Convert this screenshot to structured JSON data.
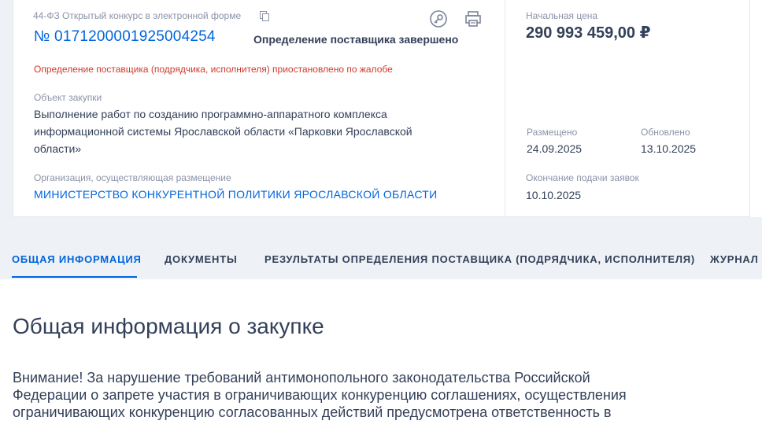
{
  "card": {
    "law_type": "44-ФЗ Открытый конкурс в электронной форме",
    "purchase_number": "№ 0171200001925004254",
    "status": "Определение поставщика завершено",
    "suspend_note": "Определение поставщика (подрядчика, исполнителя) приостановлено по жалобе",
    "object_label": "Объект закупки",
    "object_text": "Выполнение работ по созданию программно-аппаратного комплекса информационной системы Ярославской области «Парковки Ярославской области»",
    "org_label": "Организация, осуществляющая размещение",
    "org_name": "МИНИСТЕРСТВО КОНКУРЕНТНОЙ ПОЛИТИКИ ЯРОСЛАВСКОЙ ОБЛАСТИ",
    "price_label": "Начальная цена",
    "price": "290 993 459,00 ₽",
    "placed_label": "Размещено",
    "placed_date": "24.09.2025",
    "updated_label": "Обновлено",
    "updated_date": "13.10.2025",
    "end_label": "Окончание подачи заявок",
    "end_date": "10.10.2025",
    "icons": [
      "copy-icon",
      "key-icon",
      "print-icon"
    ]
  },
  "tabs": [
    {
      "label": "ОБЩАЯ ИНФОРМАЦИЯ",
      "active": true
    },
    {
      "label": "ДОКУМЕНТЫ",
      "active": false
    },
    {
      "label": "РЕЗУЛЬТАТЫ ОПРЕДЕЛЕНИЯ ПОСТАВЩИКА (ПОДРЯДЧИКА, ИСПОЛНИТЕЛЯ)",
      "active": false
    },
    {
      "label": "ЖУРНАЛ",
      "active": false
    }
  ],
  "content": {
    "title": "Общая информация о закупке",
    "warning": "Внимание! За нарушение требований антимонопольного законодательства Российской Федерации о запрете участия в ограничивающих конкуренцию соглашениях, осуществления ограничивающих конкуренцию согласованных действий предусмотрена ответственность в"
  },
  "colors": {
    "accent": "#0065dd",
    "alert": "#d0392b",
    "text": "#334059",
    "muted": "#8a93a6",
    "background": "#eef1f5"
  }
}
